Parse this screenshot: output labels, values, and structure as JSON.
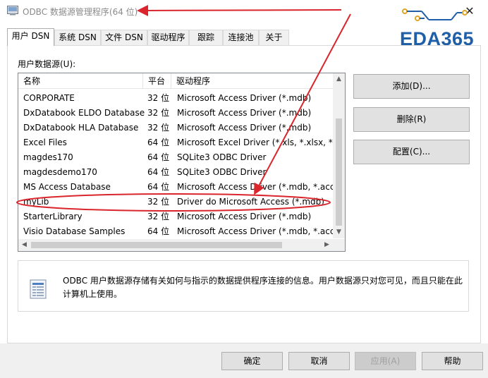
{
  "window": {
    "title": "ODBC 数据源管理程序(64 位)",
    "close_glyph": "✕"
  },
  "logo": {
    "text": "EDA365"
  },
  "tabs": [
    "用户 DSN",
    "系统 DSN",
    "文件 DSN",
    "驱动程序",
    "跟踪",
    "连接池",
    "关于"
  ],
  "list": {
    "label": "用户数据源(U):",
    "headers": [
      "名称",
      "平台",
      "驱动程序"
    ],
    "rows": [
      [
        "CORPORATE",
        "32 位",
        "Microsoft Access Driver (*.mdb)"
      ],
      [
        "DxDatabook ELDO Database",
        "32 位",
        "Microsoft Access Driver (*.mdb)"
      ],
      [
        "DxDatabook HLA Database",
        "32 位",
        "Microsoft Access Driver (*.mdb)"
      ],
      [
        "Excel Files",
        "64 位",
        "Microsoft Excel Driver (*.xls, *.xlsx, *.xl"
      ],
      [
        "magdes170",
        "64 位",
        "SQLite3 ODBC Driver"
      ],
      [
        "magdesdemo170",
        "64 位",
        "SQLite3 ODBC Driver"
      ],
      [
        "MS Access Database",
        "64 位",
        "Microsoft Access Driver (*.mdb, *.acco"
      ],
      [
        "myLib",
        "32 位",
        "Driver do Microsoft Access (*.mdb)"
      ],
      [
        "StarterLibrary",
        "32 位",
        "Microsoft Access Driver (*.mdb)"
      ],
      [
        "Visio Database Samples",
        "64 位",
        "Microsoft Access Driver (*.mdb, *.acco"
      ]
    ],
    "highlighted_row": "myLib"
  },
  "buttons": {
    "add": "添加(D)...",
    "remove": "删除(R)",
    "configure": "配置(C)..."
  },
  "info": {
    "text": "ODBC 用户数据源存储有关如何与指示的数据提供程序连接的信息。用户数据源只对您可见，而且只能在此计算机上使用。"
  },
  "footer": {
    "ok": "确定",
    "cancel": "取消",
    "apply": "应用(A)",
    "help": "帮助"
  },
  "colors": {
    "annotation_red": "#d9252b",
    "logo_blue": "#1f5fa8",
    "logo_gold": "#e0a526"
  }
}
